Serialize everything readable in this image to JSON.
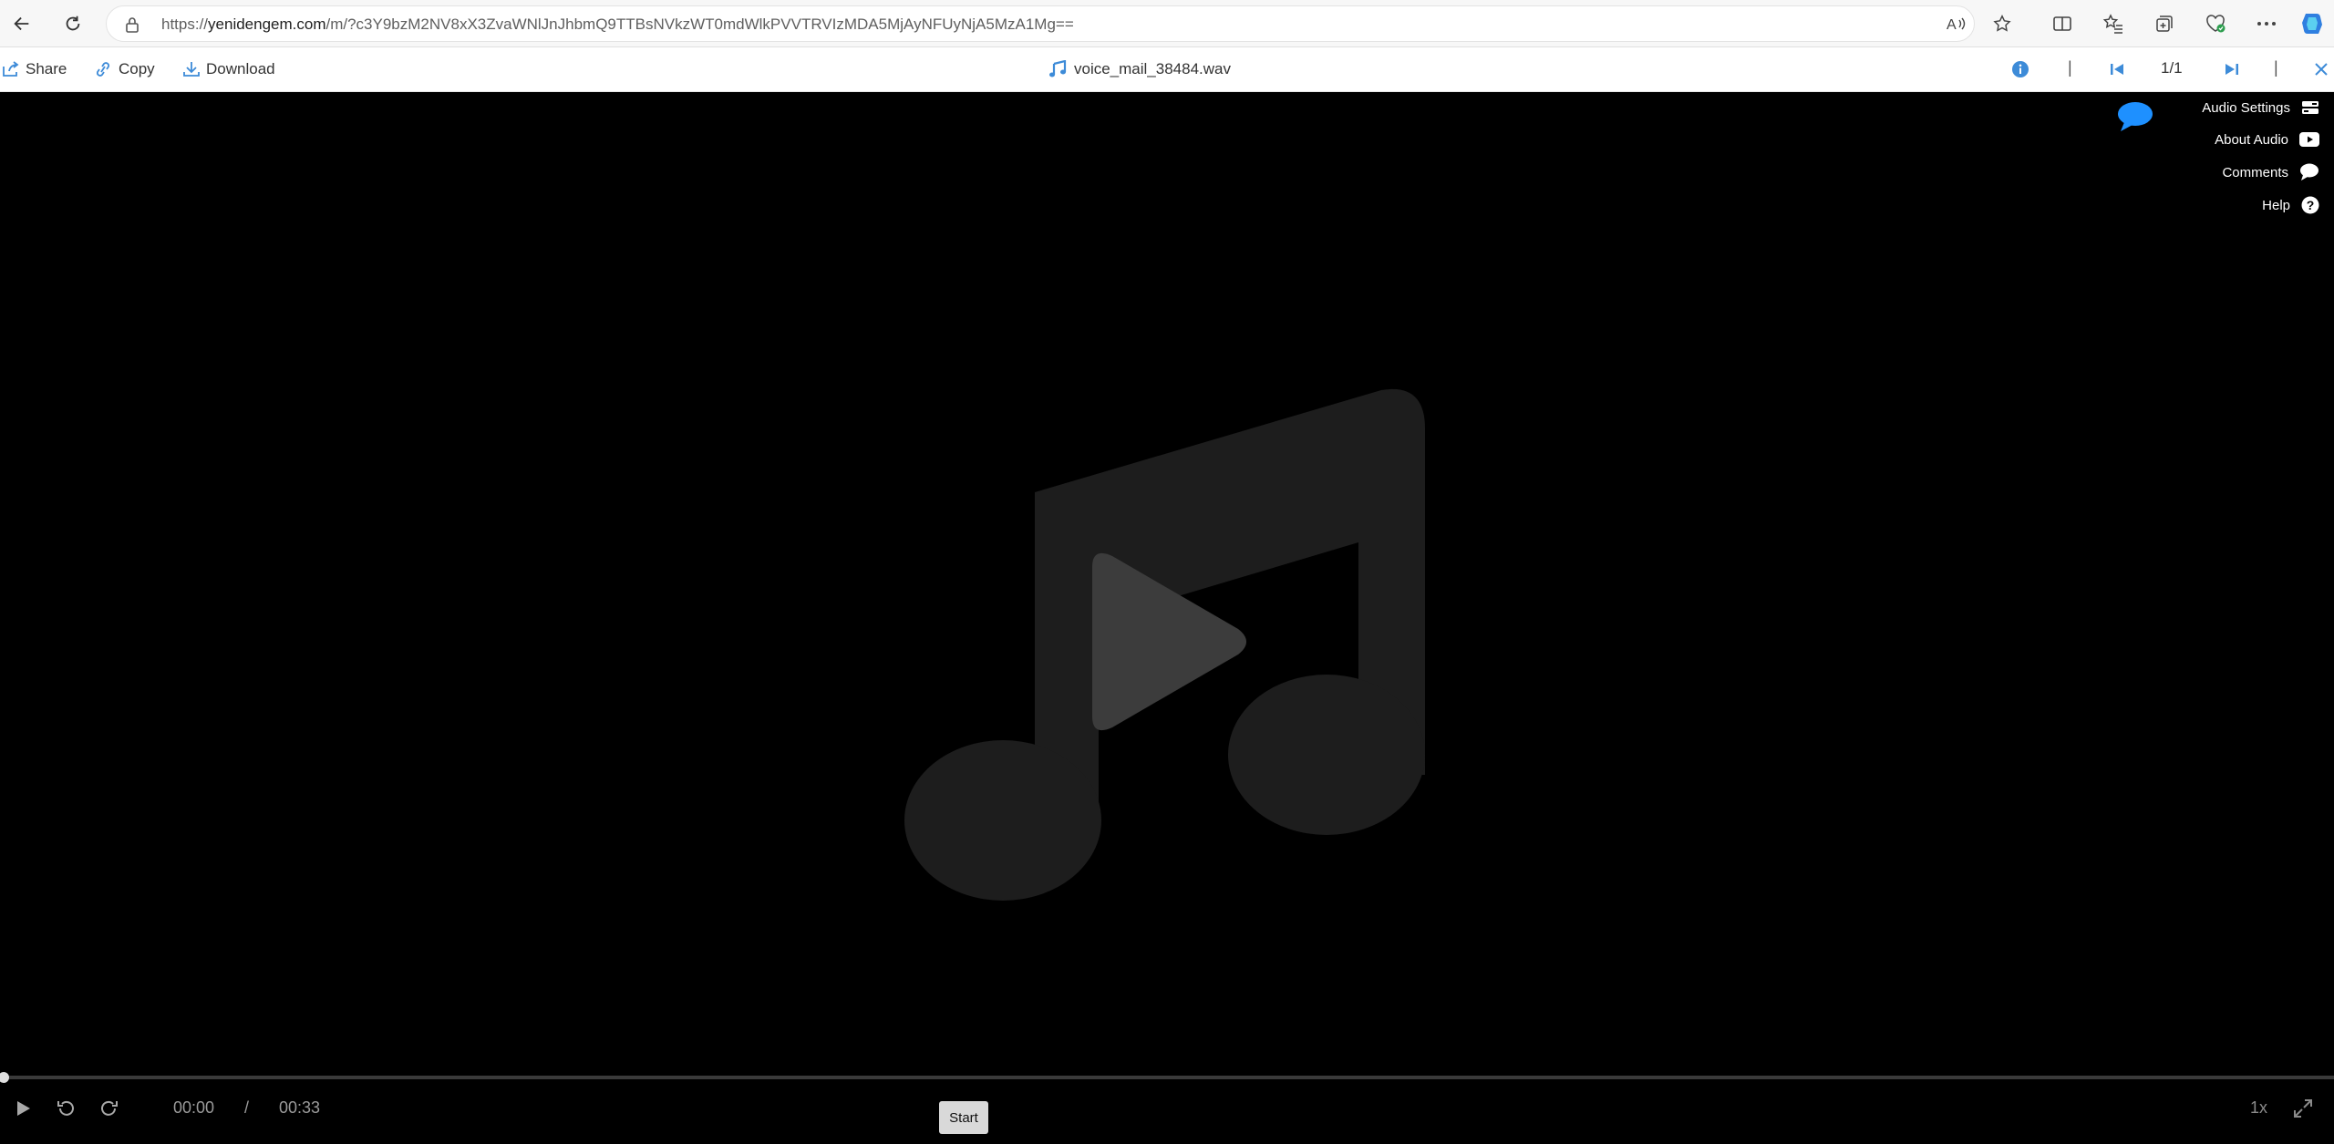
{
  "browser": {
    "url_prefix": "https://",
    "url_host": "yenidengem.com",
    "url_rest": "/m/?c3Y9bzM2NV8xX3ZvaWNlJnJhbmQ9TTBsNVkzWT0mdWlkPVVTRVIzMDA5MjAyNFUyNjA5MzA1Mg=="
  },
  "viewer": {
    "share_label": "Share",
    "copy_label": "Copy",
    "download_label": "Download",
    "file_name": "voice_mail_38484.wav",
    "page_count": "1/1",
    "separator": "|"
  },
  "side_menu": {
    "items": [
      {
        "label": "Audio Settings",
        "icon": "settings-toggle-icon"
      },
      {
        "label": "About Audio",
        "icon": "youtube-icon"
      },
      {
        "label": "Comments",
        "icon": "comment-icon"
      },
      {
        "label": "Help",
        "icon": "help-icon"
      }
    ]
  },
  "player": {
    "current_time": "00:00",
    "time_separator": "/",
    "duration": "00:33",
    "progress": 0,
    "start_label": "Start",
    "speed": "1x"
  },
  "colors": {
    "accent_blue": "#3d8bd8",
    "chat_blue": "#1e90ff",
    "stage_bg": "#000000"
  }
}
